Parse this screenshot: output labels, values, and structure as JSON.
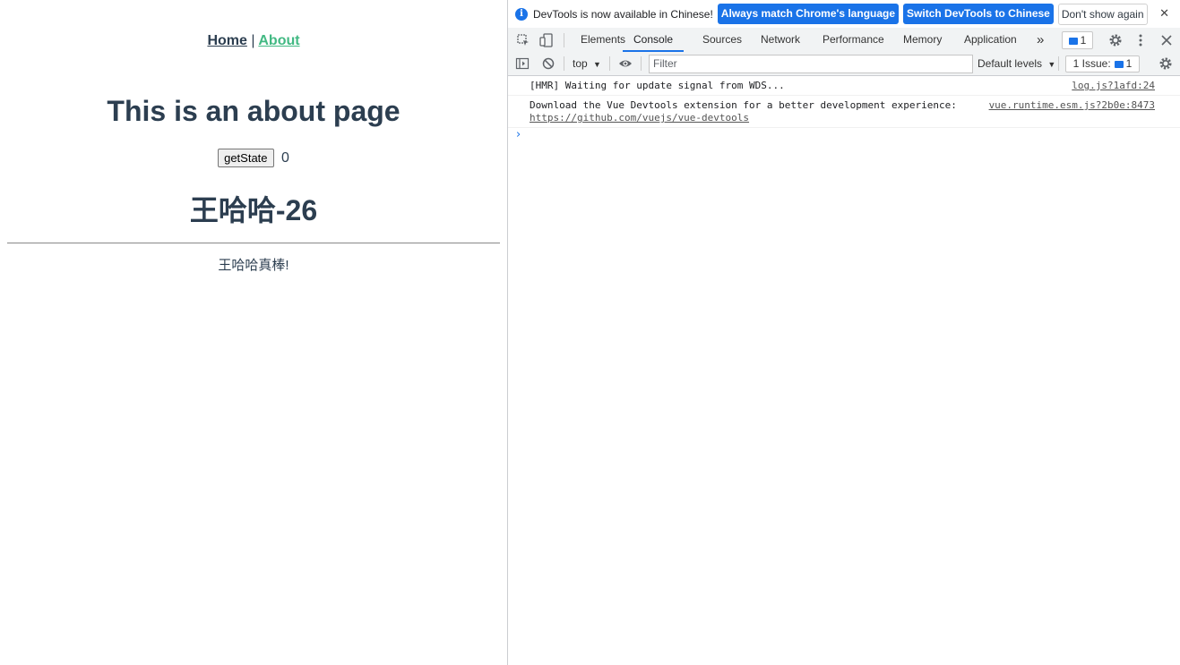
{
  "page": {
    "nav": {
      "home": "Home",
      "separator": "|",
      "about": "About"
    },
    "title": "This is an about page",
    "get_state_button": "getState",
    "count": "0",
    "name_title": "王哈哈-26",
    "praise": "王哈哈真棒!"
  },
  "devtools": {
    "infobar": {
      "text": "DevTools is now available in Chinese!",
      "btn_match": "Always match Chrome's language",
      "btn_switch": "Switch DevTools to Chinese",
      "btn_dismiss": "Don't show again",
      "close": "✕"
    },
    "tabs": [
      "Elements",
      "Console",
      "Sources",
      "Network",
      "Performance",
      "Memory",
      "Application"
    ],
    "more_tabs": "»",
    "messages_count": "1",
    "toolbar": {
      "context": "top",
      "filter_placeholder": "Filter",
      "levels": "Default levels",
      "issues_label": "1 Issue:",
      "issues_count": "1"
    },
    "logs": [
      {
        "message": "[HMR] Waiting for update signal from WDS...",
        "source": "log.js?1afd:24"
      },
      {
        "message": "Download the Vue Devtools extension for a better development experience:",
        "link": "https://github.com/vuejs/vue-devtools",
        "source": "vue.runtime.esm.js?2b0e:8473"
      }
    ],
    "prompt": "›",
    "accent_color": "#1a73e8"
  }
}
